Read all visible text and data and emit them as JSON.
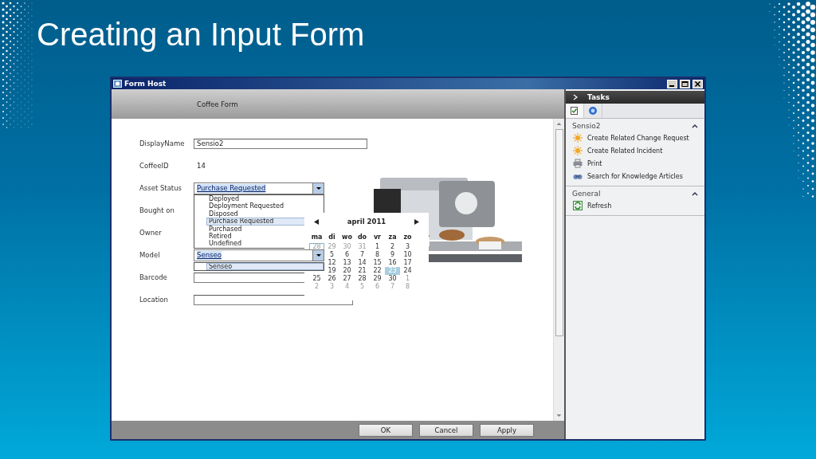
{
  "slide": {
    "title": "Creating an Input Form"
  },
  "window": {
    "title": "Form Host"
  },
  "form": {
    "title": "Coffee Form",
    "fields": [
      {
        "label": "DisplayName",
        "kind": "text",
        "value": "Sensio2"
      },
      {
        "label": "CoffeeID",
        "kind": "static",
        "value": "14"
      },
      {
        "label": "Asset Status",
        "kind": "combo",
        "value": "Purchase Requested",
        "highlighted": true
      },
      {
        "label": "Bought on",
        "kind": "covered"
      },
      {
        "label": "Owner",
        "kind": "covered"
      },
      {
        "label": "Model",
        "kind": "combo",
        "value": "Senseo",
        "highlighted": true
      },
      {
        "label": "Barcode",
        "kind": "text"
      },
      {
        "label": "Location",
        "kind": "text"
      }
    ]
  },
  "status_dropdown": {
    "items": [
      {
        "label": "Deployed",
        "selected": false
      },
      {
        "label": "Deployment Requested",
        "selected": false
      },
      {
        "label": "Disposed",
        "selected": false
      },
      {
        "label": "Purchase Requested",
        "selected": true
      },
      {
        "label": "Purchased",
        "selected": false
      },
      {
        "label": "Retired",
        "selected": false
      },
      {
        "label": "Undefined",
        "selected": false
      }
    ]
  },
  "model_dropdown": {
    "items": [
      {
        "label": "Senseo",
        "selected": true
      }
    ]
  },
  "calendar": {
    "title": "april 2011",
    "weekdays": [
      "ma",
      "di",
      "wo",
      "do",
      "vr",
      "za",
      "zo"
    ],
    "weeks": [
      [
        {
          "day": "28",
          "kind": "today",
          "selected": false
        },
        {
          "day": "29",
          "kind": "adjacent",
          "selected": false
        },
        {
          "day": "30",
          "kind": "adjacent",
          "selected": false
        },
        {
          "day": "31",
          "kind": "adjacent",
          "selected": false
        },
        {
          "day": "1",
          "kind": "current",
          "selected": false
        },
        {
          "day": "2",
          "kind": "current",
          "selected": false
        },
        {
          "day": "3",
          "kind": "current",
          "selected": false
        }
      ],
      [
        {
          "day": "5",
          "kind": "current",
          "selected": false
        },
        {
          "day": "6",
          "kind": "current",
          "selected": false
        },
        {
          "day": "7",
          "kind": "current",
          "selected": false
        },
        {
          "day": "8",
          "kind": "current",
          "selected": false
        },
        {
          "day": "9",
          "kind": "current",
          "selected": false
        },
        {
          "day": "10",
          "kind": "current",
          "selected": false
        }
      ],
      [
        {
          "day": "12",
          "kind": "current",
          "selected": false
        },
        {
          "day": "13",
          "kind": "current",
          "selected": false
        },
        {
          "day": "14",
          "kind": "current",
          "selected": false
        },
        {
          "day": "15",
          "kind": "current",
          "selected": false
        },
        {
          "day": "16",
          "kind": "current",
          "selected": false
        },
        {
          "day": "17",
          "kind": "current",
          "selected": false
        }
      ],
      [
        {
          "day": "19",
          "kind": "current",
          "selected": false
        },
        {
          "day": "20",
          "kind": "current",
          "selected": false
        },
        {
          "day": "21",
          "kind": "current",
          "selected": false
        },
        {
          "day": "22",
          "kind": "current",
          "selected": false
        },
        {
          "day": "23",
          "kind": "current",
          "selected": true
        },
        {
          "day": "24",
          "kind": "current",
          "selected": false
        }
      ],
      [
        {
          "day": "25",
          "kind": "current",
          "selected": false
        },
        {
          "day": "26",
          "kind": "current",
          "selected": false
        },
        {
          "day": "27",
          "kind": "current",
          "selected": false
        },
        {
          "day": "28",
          "kind": "current",
          "selected": false
        },
        {
          "day": "29",
          "kind": "current",
          "selected": false
        },
        {
          "day": "30",
          "kind": "current",
          "selected": false
        },
        {
          "day": "1",
          "kind": "adjacent",
          "selected": false
        }
      ],
      [
        {
          "day": "2",
          "kind": "adjacent",
          "selected": false
        },
        {
          "day": "3",
          "kind": "adjacent",
          "selected": false
        },
        {
          "day": "4",
          "kind": "adjacent",
          "selected": false
        },
        {
          "day": "5",
          "kind": "adjacent",
          "selected": false
        },
        {
          "day": "6",
          "kind": "adjacent",
          "selected": false
        },
        {
          "day": "7",
          "kind": "adjacent",
          "selected": false
        },
        {
          "day": "8",
          "kind": "adjacent",
          "selected": false
        }
      ]
    ]
  },
  "buttons": [
    "OK",
    "Cancel",
    "Apply"
  ],
  "tasks": {
    "title": "Tasks",
    "tabs": [
      {
        "kind": "tasks",
        "selected": true
      },
      {
        "kind": "help",
        "selected": false
      }
    ],
    "sections": [
      {
        "title": "Sensio2",
        "expanded": true,
        "items": [
          {
            "label": "Create Related Change Request",
            "kind": "sun"
          },
          {
            "label": "Create Related Incident",
            "kind": "sun"
          },
          {
            "label": "Print",
            "kind": "printer"
          },
          {
            "label": "Search for Knowledge Articles",
            "kind": "binoculars"
          }
        ]
      },
      {
        "title": "General",
        "expanded": true,
        "items": [
          {
            "label": "Refresh",
            "kind": "refresh"
          }
        ]
      }
    ]
  }
}
